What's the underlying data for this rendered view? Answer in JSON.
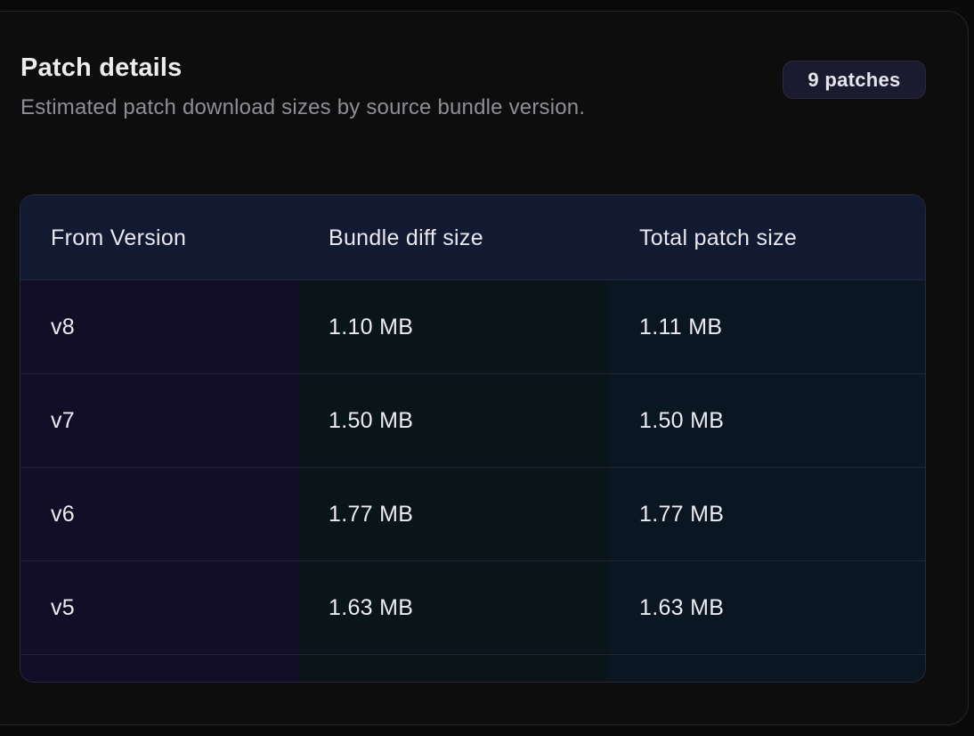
{
  "header": {
    "title": "Patch details",
    "subtitle": "Estimated patch download sizes by source bundle version.",
    "badge": "9 patches"
  },
  "table": {
    "columns": [
      "From Version",
      "Bundle diff size",
      "Total patch size"
    ],
    "rows": [
      {
        "from": "v8",
        "diff": "1.10 MB",
        "total": "1.11 MB"
      },
      {
        "from": "v7",
        "diff": "1.50 MB",
        "total": "1.50 MB"
      },
      {
        "from": "v6",
        "diff": "1.77 MB",
        "total": "1.77 MB"
      },
      {
        "from": "v5",
        "diff": "1.63 MB",
        "total": "1.63 MB"
      }
    ]
  },
  "colors": {
    "background": "#0a0a0a",
    "header_row": "#111a30",
    "col_version": "#130e27",
    "col_diff": "#0a1519",
    "col_total": "#0a1622",
    "badge": "#1c1a2e"
  }
}
